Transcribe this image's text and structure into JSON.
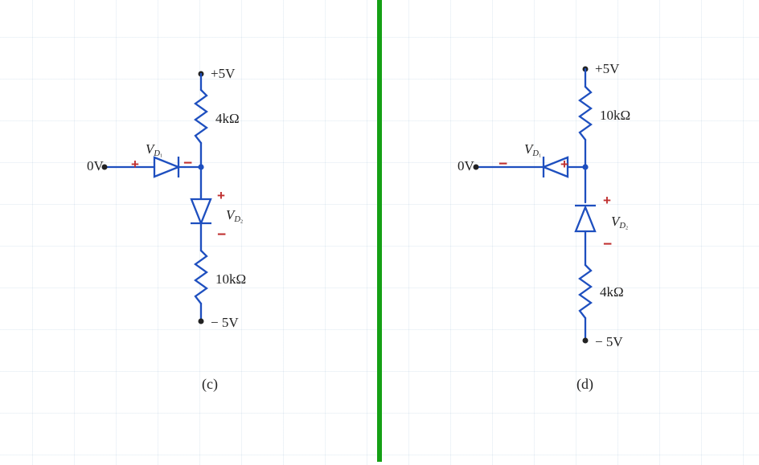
{
  "divider_color": "#15a015",
  "circuits": {
    "c": {
      "fig_label": "(c)",
      "top_supply": "+5V",
      "bottom_supply": "− 5V",
      "left_terminal": "0V",
      "r_top": "4kΩ",
      "r_bottom": "10kΩ",
      "d1": {
        "name_html": "V<sub>D<sub>1</sub></sub>",
        "left_sign": "+",
        "right_sign": "−",
        "direction": "right"
      },
      "d2": {
        "name_html": "V<sub>D<sub>2</sub></sub>",
        "top_sign": "+",
        "bottom_sign": "−",
        "direction": "down"
      }
    },
    "d": {
      "fig_label": "(d)",
      "top_supply": "+5V",
      "bottom_supply": "− 5V",
      "left_terminal": "0V",
      "r_top": "10kΩ",
      "r_bottom": "4kΩ",
      "d1": {
        "name_html": "V<sub>D<sub>1</sub></sub>",
        "left_sign": "−",
        "right_sign": "+",
        "direction": "left"
      },
      "d2": {
        "name_html": "V<sub>D<sub>2</sub></sub>",
        "top_sign": "+",
        "bottom_sign": "−",
        "direction": "up"
      }
    }
  }
}
